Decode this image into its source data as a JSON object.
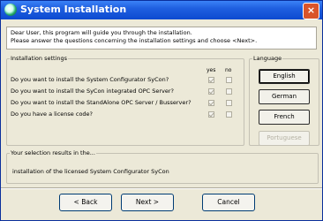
{
  "window": {
    "title": "System Installation",
    "close_glyph": "×"
  },
  "intro": {
    "line1": "Dear User, this program will guide you through the installation.",
    "line2": "Please answer the questions concerning the installation settings and choose <Next>."
  },
  "settings": {
    "legend": "Installation settings",
    "yes_label": "yes",
    "no_label": "no",
    "questions": [
      {
        "text": "Do you want to install the System Configurator SyCon?",
        "yes": true,
        "no": false
      },
      {
        "text": "Do you want to install the SyCon integrated OPC Server?",
        "yes": true,
        "no": false
      },
      {
        "text": "Do you want to install the StandAlone OPC Server / Busserver?",
        "yes": true,
        "no": false
      },
      {
        "text": "Do you have a license code?",
        "yes": true,
        "no": false
      }
    ]
  },
  "language": {
    "legend": "Language",
    "buttons": [
      "English",
      "German",
      "French",
      "Portuguese"
    ]
  },
  "result": {
    "legend": "Your selection results in the...",
    "text": "installation of the licensed System Configurator SyCon"
  },
  "nav": {
    "back": "< Back",
    "next": "Next >",
    "cancel": "Cancel"
  }
}
